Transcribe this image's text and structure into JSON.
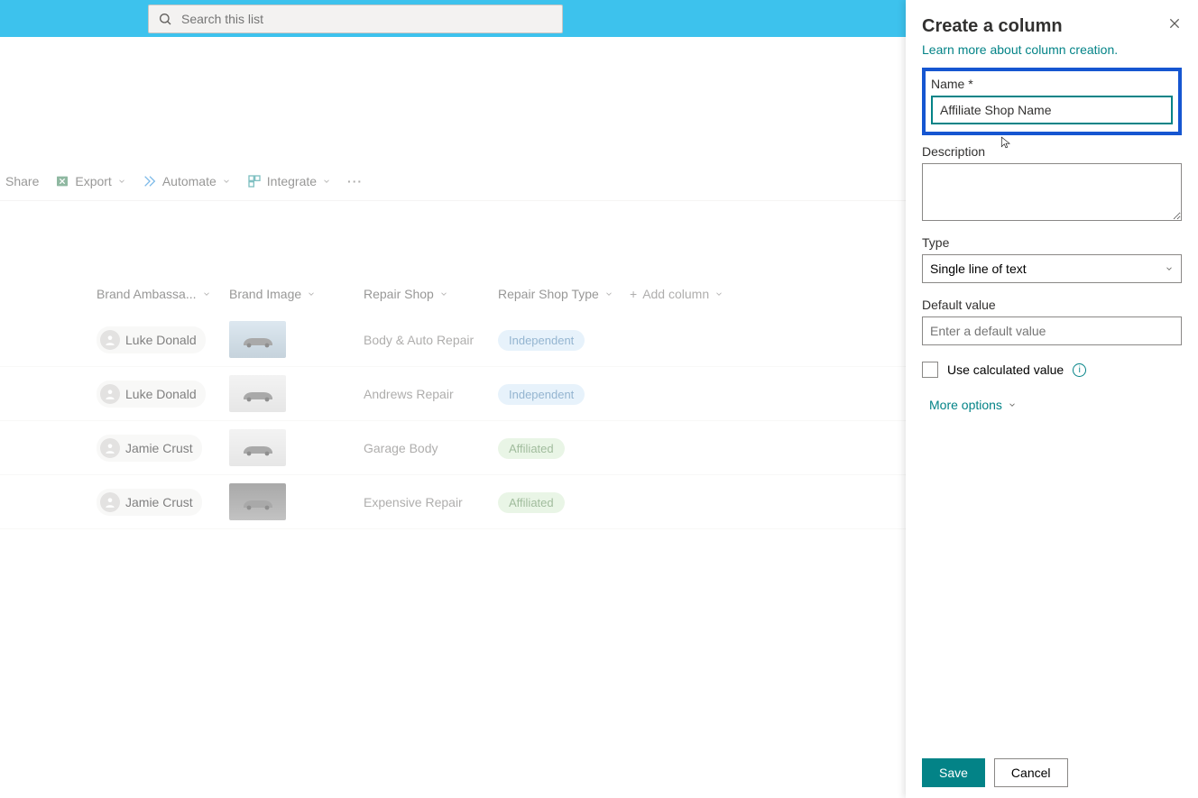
{
  "search": {
    "placeholder": "Search this list"
  },
  "toolbar": {
    "share": "Share",
    "export": "Export",
    "automate": "Automate",
    "integrate": "Integrate"
  },
  "columns": {
    "ambassador": "Brand Ambassa...",
    "image": "Brand Image",
    "shop": "Repair Shop",
    "shopType": "Repair Shop Type",
    "add": "Add column"
  },
  "rows": [
    {
      "ambassador": "Luke Donald",
      "shop": "Body & Auto Repair",
      "type": "Independent",
      "typeClass": "ind",
      "thumb": "road"
    },
    {
      "ambassador": "Luke Donald",
      "shop": "Andrews Repair",
      "type": "Independent",
      "typeClass": "ind",
      "thumb": "light"
    },
    {
      "ambassador": "Jamie Crust",
      "shop": "Garage Body",
      "type": "Affiliated",
      "typeClass": "aff",
      "thumb": "light"
    },
    {
      "ambassador": "Jamie Crust",
      "shop": "Expensive Repair",
      "type": "Affiliated",
      "typeClass": "aff",
      "thumb": "dark"
    }
  ],
  "panel": {
    "title": "Create a column",
    "learn": "Learn more about column creation.",
    "nameLabel": "Name *",
    "nameValue": "Affiliate Shop Name",
    "descLabel": "Description",
    "typeLabel": "Type",
    "typeValue": "Single line of text",
    "defaultLabel": "Default value",
    "defaultPlaceholder": "Enter a default value",
    "useCalc": "Use calculated value",
    "moreOptions": "More options",
    "save": "Save",
    "cancel": "Cancel"
  }
}
